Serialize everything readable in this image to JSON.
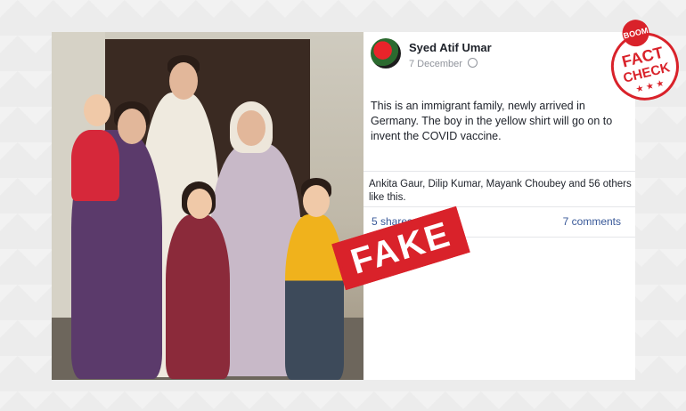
{
  "post": {
    "author": "Syed Atif Umar",
    "date": "7 December",
    "text": "This is an immigrant family, newly arrived in Germany. The boy in the yellow shirt will go on to invent the COVID vaccine.",
    "likes": "Ankita Gaur, Dilip Kumar, Mayank Choubey and 56 others like this.",
    "shares": "5 shares",
    "comments": "7 comments",
    "partial_link": "at"
  },
  "stamp": {
    "label": "FAKE",
    "color": "#d9222a"
  },
  "badge": {
    "top": "BOOM",
    "line1": "FACT",
    "line2": "CHECK",
    "stars": "★ ★ ★"
  },
  "icons": {
    "privacy": "globe-icon",
    "avatar": "profile-picture"
  }
}
